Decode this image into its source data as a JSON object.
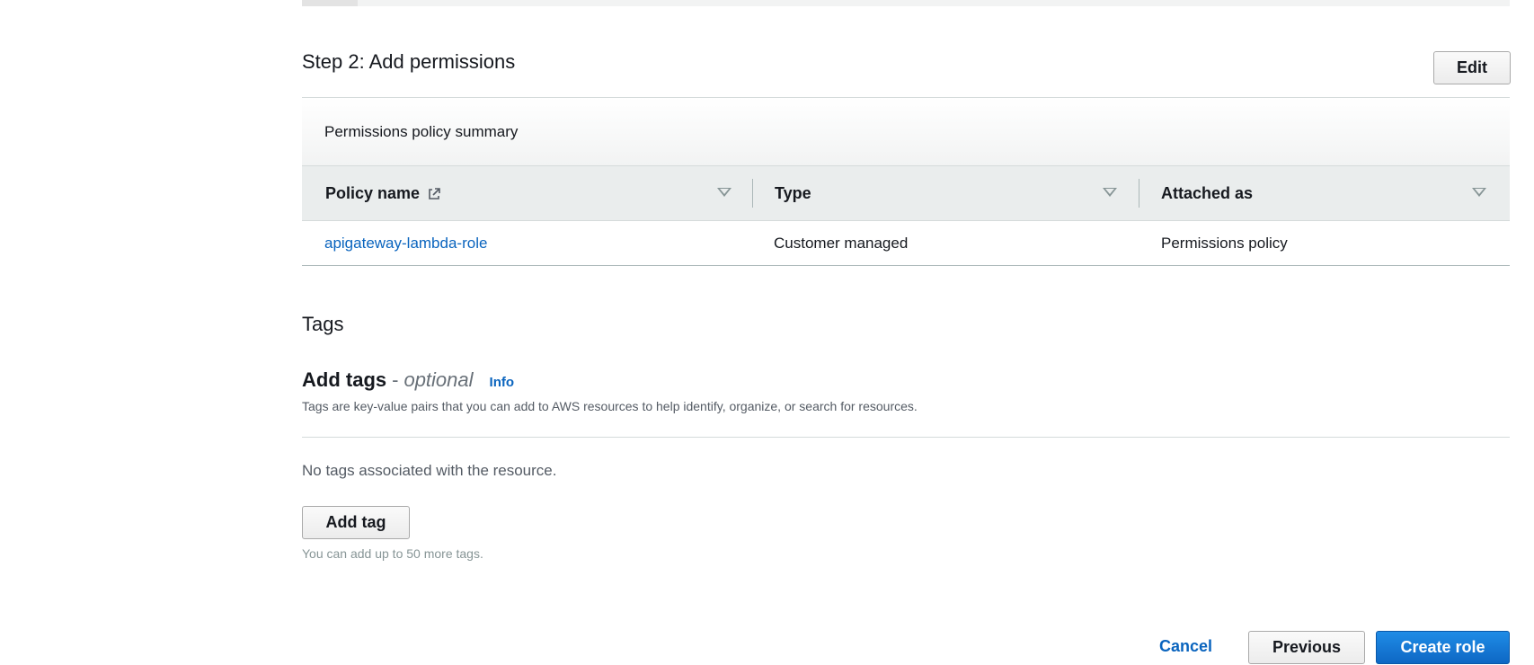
{
  "step2": {
    "title": "Step 2: Add permissions",
    "edit_label": "Edit",
    "summary_title": "Permissions policy summary",
    "columns": [
      "Policy name",
      "Type",
      "Attached as"
    ],
    "rows": [
      {
        "policy_name": "apigateway-lambda-role",
        "type": "Customer managed",
        "attached_as": "Permissions policy"
      }
    ]
  },
  "tags": {
    "section_title": "Tags",
    "add_tags_title": "Add tags",
    "separator": "-",
    "optional_label": "optional",
    "info_label": "Info",
    "description": "Tags are key-value pairs that you can add to AWS resources to help identify, organize, or search for resources.",
    "empty_message": "No tags associated with the resource.",
    "add_tag_label": "Add tag",
    "limit_note": "You can add up to 50 more tags."
  },
  "footer": {
    "cancel_label": "Cancel",
    "previous_label": "Previous",
    "create_label": "Create role"
  },
  "colors": {
    "link": "#0a64be",
    "primary": "#0e67c4",
    "header_bg": "#eaeded"
  },
  "icons": {
    "external_link": "external-link-icon",
    "sort": "caret-down-icon"
  }
}
